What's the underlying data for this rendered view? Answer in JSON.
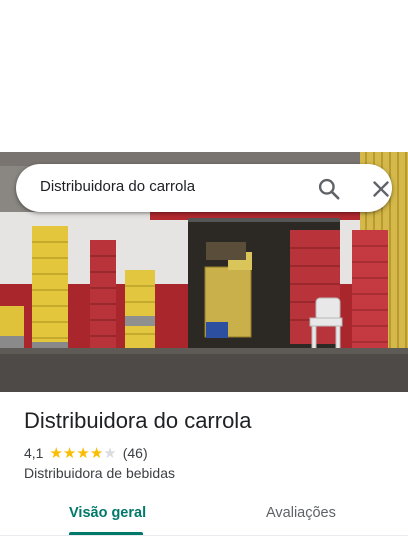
{
  "search": {
    "query": "Distribuidora do carrola",
    "search_icon": "search-icon",
    "close_icon": "close-icon"
  },
  "photo": {
    "subject": "storefront-photo"
  },
  "place": {
    "name": "Distribuidora do carrola",
    "rating": "4,1",
    "rating_value": 4.1,
    "stars_filled": 4,
    "stars_total": 5,
    "review_count": "(46)",
    "category": "Distribuidora de bebidas"
  },
  "tabs": [
    {
      "label": "Visão geral",
      "active": true
    },
    {
      "label": "Avaliações",
      "active": false
    }
  ],
  "colors": {
    "accent": "#00796b",
    "star": "#fbbc04",
    "star_empty": "#dadce0",
    "text_primary": "#202124",
    "text_secondary": "#3c4043"
  }
}
